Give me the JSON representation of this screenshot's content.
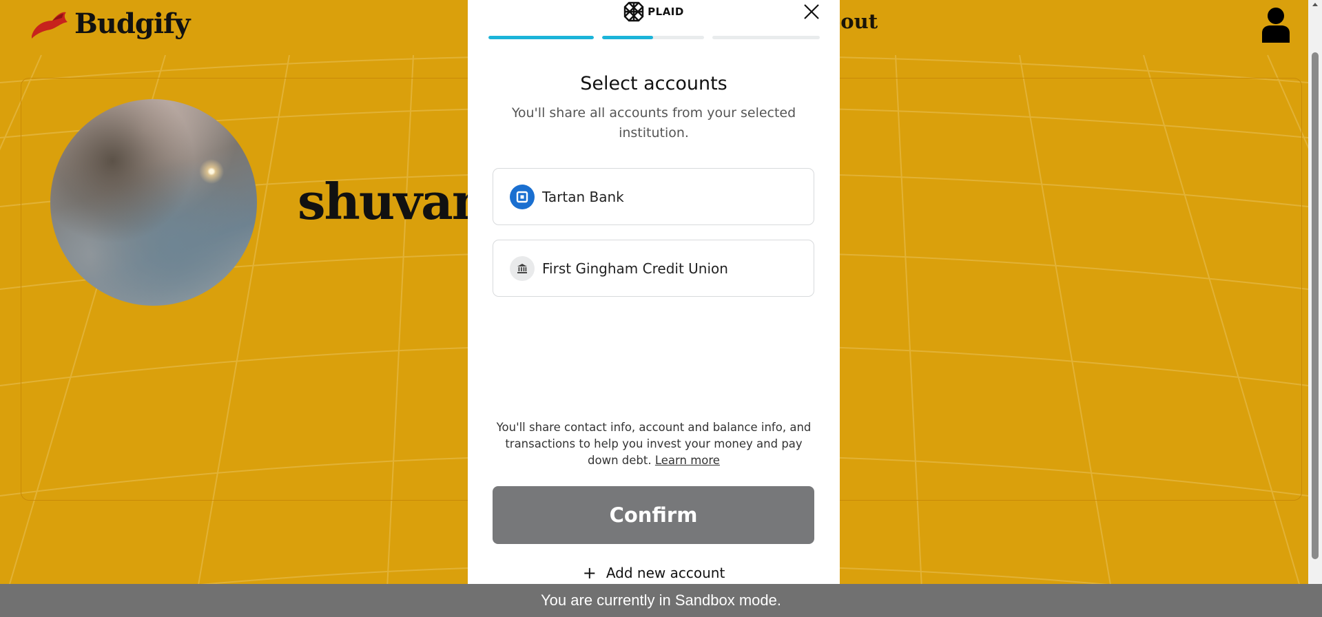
{
  "app": {
    "brand": "Budgify",
    "nav_about": "bout",
    "profile_name": "shuvam",
    "brand_color": "#daa00c"
  },
  "plaid": {
    "logo_text": "PLAID",
    "progress": [
      1.0,
      0.5,
      0.0
    ],
    "title": "Select accounts",
    "subtitle": "You'll share all accounts from your selected institution.",
    "accounts": [
      {
        "label": "Tartan Bank",
        "icon": "tartan-bank-icon"
      },
      {
        "label": "First Gingham Credit Union",
        "icon": "bank-building-icon"
      }
    ],
    "disclosure": "You'll share contact info, account and balance info, and transactions to help you invest your money and pay down debt.",
    "learn_more": "Learn more",
    "confirm_label": "Confirm",
    "add_account_label": "Add new account"
  },
  "footer": {
    "sandbox_text": "You are currently in Sandbox mode."
  }
}
